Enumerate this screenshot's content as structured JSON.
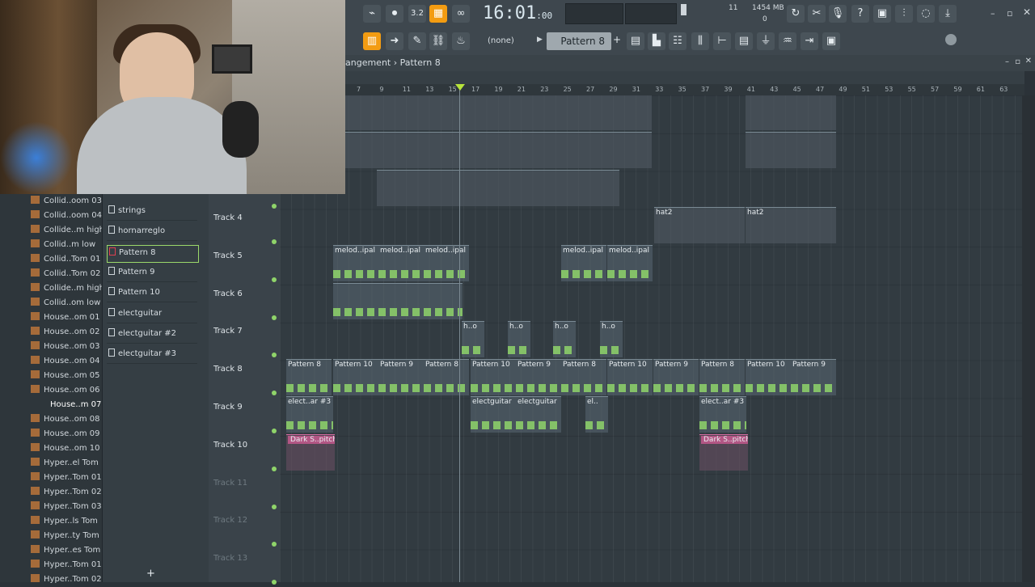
{
  "toolbar": {
    "time": "16:01",
    "time_sub": ":00",
    "cpu": "11",
    "memory": "1454 MB",
    "memory_sub": "0",
    "pattern_dropdown": "(none)",
    "current_pattern": "Pattern 8"
  },
  "playlist": {
    "breadcrumb": "angement › Pattern 8",
    "ruler": [
      "7",
      "9",
      "11",
      "13",
      "15",
      "17",
      "19",
      "21",
      "23",
      "25",
      "27",
      "29",
      "31",
      "33",
      "35",
      "37",
      "39",
      "41",
      "43",
      "45",
      "47",
      "49",
      "51",
      "53",
      "55",
      "57",
      "59",
      "61",
      "63"
    ]
  },
  "browser": {
    "items": [
      "Collid..oom 03",
      "Collid..oom 04",
      "Collide..m high",
      "Collid..m low",
      "Collid..Tom 01",
      "Collid..Tom 02",
      "Collide..m high",
      "Collid..om low",
      "House..om 01",
      "House..om 02",
      "House..om 03",
      "House..om 04",
      "House..om 05",
      "House..om 06",
      "House..m 07",
      "House..om 08",
      "House..om 09",
      "House..om 10",
      "Hyper..el Tom",
      "Hyper..Tom 01",
      "Hyper..Tom 02",
      "Hyper..Tom 03",
      "Hyper..ls Tom",
      "Hyper..ty Tom",
      "Hyper..es Tom",
      "Hyper..Tom 01",
      "Hyper..Tom 02"
    ]
  },
  "patterns": [
    "strings",
    "hornarreglo",
    "Pattern 8",
    "Pattern 9",
    "Pattern 10",
    "electguitar",
    "electguitar #2",
    "electguitar #3"
  ],
  "tracks": [
    "Track 4",
    "Track 5",
    "Track 6",
    "Track 7",
    "Track 8",
    "Track 9",
    "Track 10",
    "Track 11",
    "Track 12",
    "Track 13"
  ],
  "clips": {
    "hat2": "hat2",
    "melod": "melod..ipal",
    "ho": "h..o",
    "p8": "Pattern 8",
    "p9": "Pattern 9",
    "p10": "Pattern 10",
    "elec3": "elect..ar #3",
    "elec": "electguitar",
    "el": "el..",
    "dark": "Dark S..pitch"
  },
  "colors": {
    "accent": "#f39c12",
    "notes": "#8fd46a",
    "automation": "#b25684"
  }
}
